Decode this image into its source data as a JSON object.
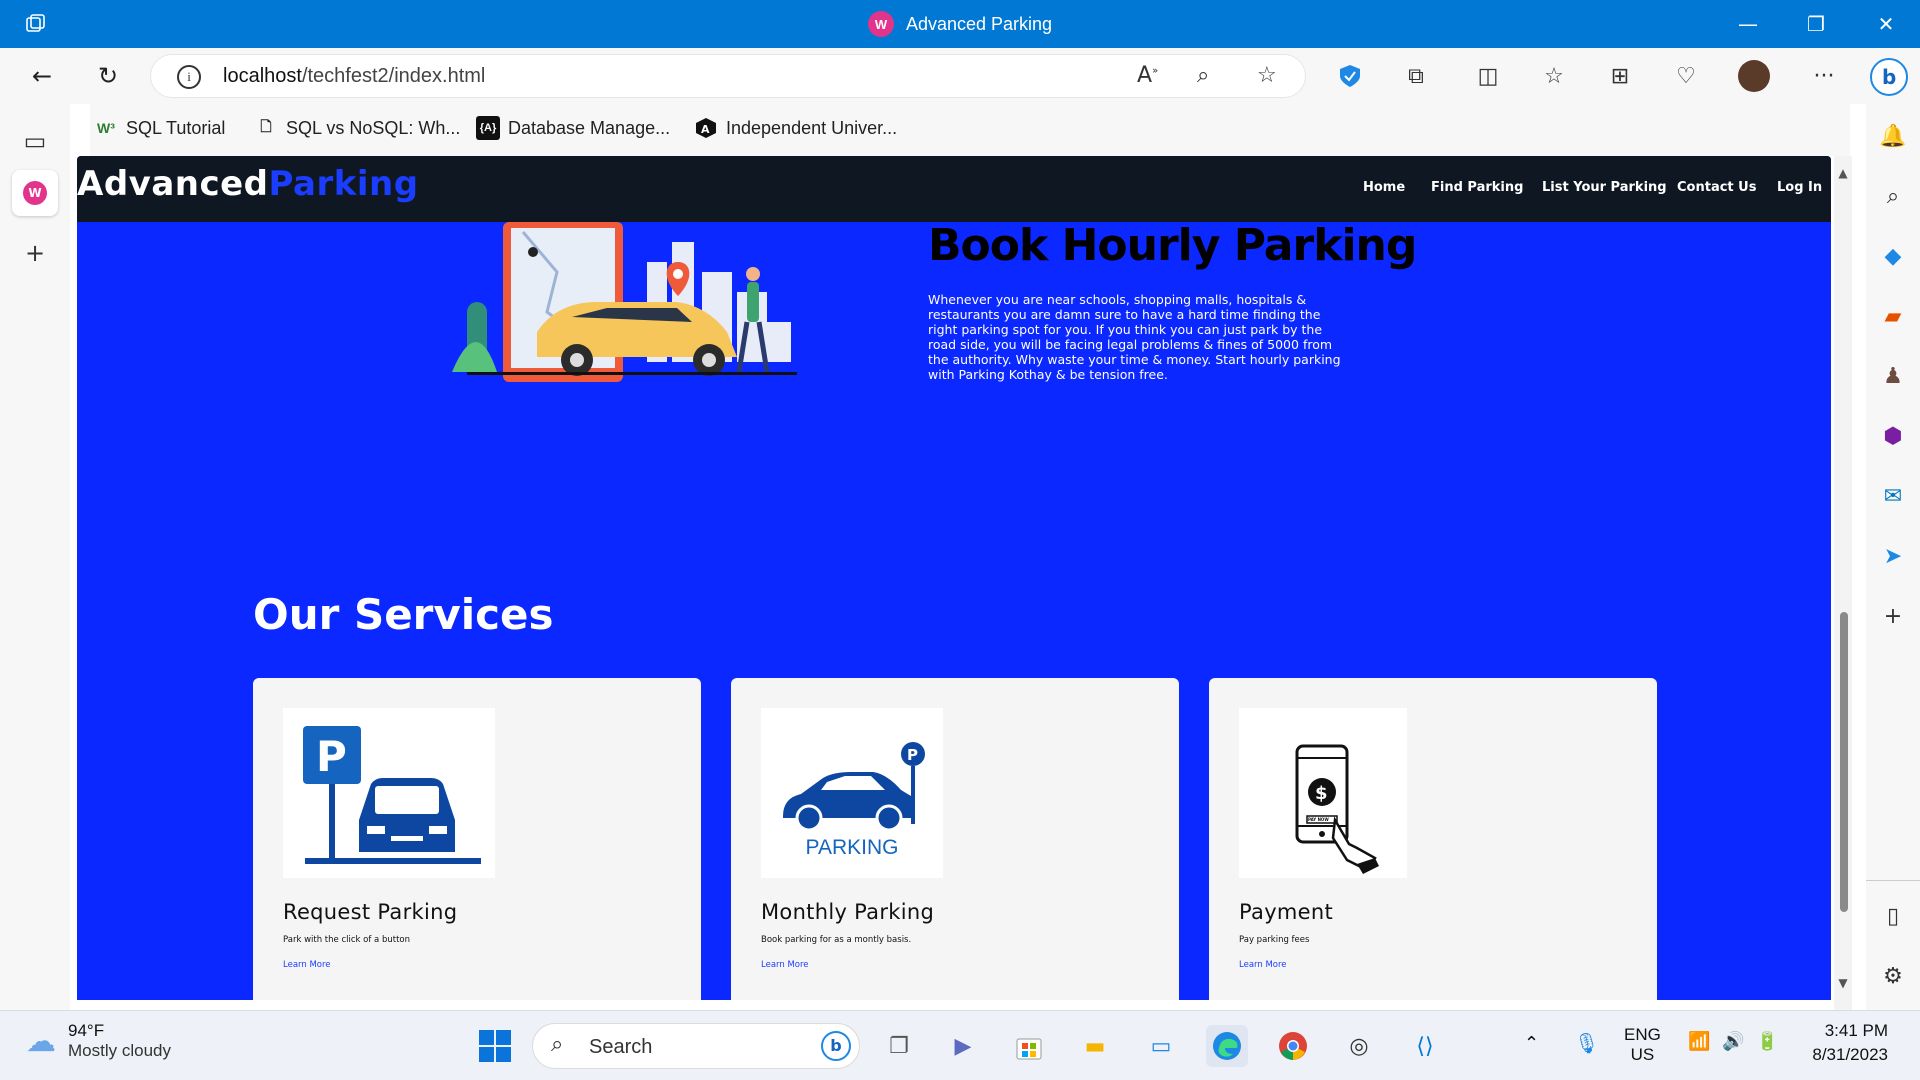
{
  "browser": {
    "window_title": "Advanced Parking",
    "url_host": "localhost",
    "url_path": "/techfest2/index.html",
    "favorites": [
      {
        "label": "SQL Tutorial"
      },
      {
        "label": "SQL vs NoSQL: Wh..."
      },
      {
        "label": "Database Manage..."
      },
      {
        "label": "Independent Univer..."
      }
    ]
  },
  "site": {
    "logo_part1": "Advanced",
    "logo_part2": "Parking",
    "nav": [
      "Home",
      "Find Parking",
      "List Your Parking",
      "Contact Us",
      "Log In"
    ],
    "hero": {
      "heading": "Book Hourly Parking",
      "paragraph": "Whenever you are near schools, shopping malls, hospitals & restaurants you are damn sure to have a hard time finding the right parking spot for you. If you think you can just park by the road side, you will be facing legal problems & fines of 5000 from the authority. Why waste your time & money. Start hourly parking with Parking Kothay & be tension free."
    },
    "services": {
      "heading": "Our Services",
      "cards": [
        {
          "title": "Request Parking",
          "desc": "Park with the click of a button",
          "link": "Learn More"
        },
        {
          "title": "Monthly Parking",
          "desc": "Book parking for as a montly basis.",
          "link": "Learn More",
          "image_text": "PARKING"
        },
        {
          "title": "Payment",
          "desc": "Pay parking fees",
          "link": "Learn More",
          "image_text": "PAY NOW"
        }
      ]
    }
  },
  "taskbar": {
    "weather_temp": "94°F",
    "weather_desc": "Mostly cloudy",
    "search_label": "Search",
    "lang1": "ENG",
    "lang2": "US",
    "time": "3:41 PM",
    "date": "8/31/2023"
  },
  "colors": {
    "page_bg": "#0a28ff",
    "nav_bg": "#0f1822",
    "titlebar": "#0078d4"
  }
}
